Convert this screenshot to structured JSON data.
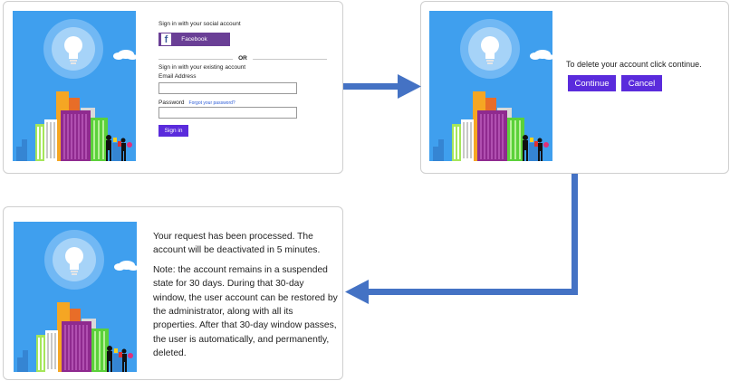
{
  "signin_panel": {
    "social_title": "Sign in with your social account",
    "facebook_label": "Facebook",
    "or_label": "OR",
    "existing_title": "Sign in with your existing account",
    "email_label": "Email Address",
    "password_label": "Password",
    "forgot_link": "Forgot your password?",
    "signin_label": "Sign in"
  },
  "delete_panel": {
    "message": "To delete your account click continue.",
    "continue_label": "Continue",
    "cancel_label": "Cancel"
  },
  "result_panel": {
    "processed": "Your request has been processed. The account will be deactivated in 5 minutes.",
    "note": "Note: the account remains in a suspended state for 30 days. During that 30-day window, the user account can be restored by the administrator, along with all its properties. After that 30-day window passes, the user is automatically, and permanently, deleted."
  },
  "colors": {
    "primary_button": "#5a2bdc",
    "facebook_button": "#6a3f96",
    "flow_arrow": "#4472c4",
    "illustration_sky": "#3f9fee"
  },
  "icons": [
    "lightbulb-icon",
    "facebook-icon",
    "arrow-right-icon",
    "arrow-down-left-icon"
  ]
}
